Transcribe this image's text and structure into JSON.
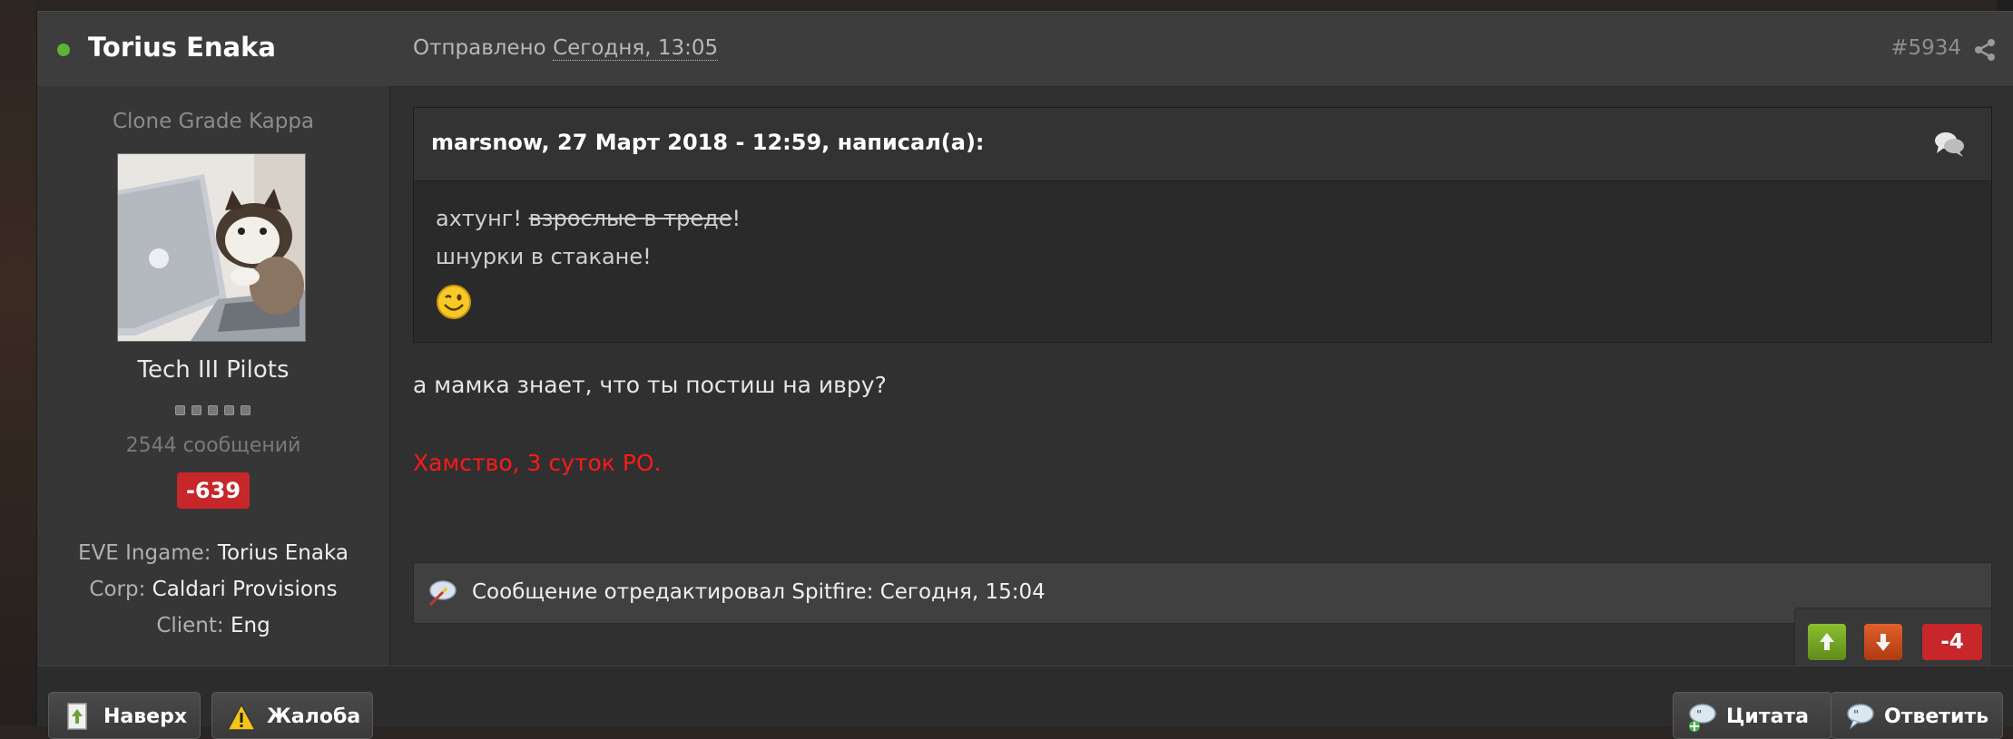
{
  "post": {
    "author": "Torius Enaka",
    "sent_label": "Отправлено",
    "sent_date": "Сегодня, 13:05",
    "post_number": "#5934"
  },
  "sidebar": {
    "user_title": "Clone Grade Kappa",
    "group": "Tech III Pilots",
    "post_count": "2544 сообщений",
    "reputation": "-639",
    "fields": [
      {
        "label": "EVE Ingame:",
        "value": "Torius Enaka"
      },
      {
        "label": "Corp:",
        "value": "Caldari Provisions"
      },
      {
        "label": "Client:",
        "value": "Eng"
      }
    ]
  },
  "quote": {
    "citation": "marsnow, 27 Март 2018 - 12:59, написал(а):",
    "line1_start": "ахтунг! ",
    "line1_strike": "взрослые в треде",
    "line1_end": "!",
    "line2": "шнурки в стакане!"
  },
  "body": {
    "text": "а мамка знает, что ты постиш на ивру?",
    "mod_note": "Хамство, 3 суток РО."
  },
  "edit_note": "Сообщение отредактировал Spitfire: Сегодня, 15:04",
  "votes": {
    "score": "-4"
  },
  "footer": {
    "top_label": "Наверх",
    "report_label": "Жалоба",
    "quote_label": "Цитата",
    "reply_label": "Ответить"
  },
  "icons": {
    "online": "online-status-icon",
    "share": "share-icon",
    "quote": "speech-bubbles-icon",
    "edit": "edit-note-icon",
    "smiley": "wink-smiley-icon",
    "up": "arrow-up-icon",
    "down": "arrow-down-icon",
    "top": "page-up-icon",
    "report": "warning-icon",
    "quote_btn": "quote-icon",
    "reply": "reply-icon"
  },
  "colors": {
    "online": "#5fb336",
    "negative_badge": "#c7262b",
    "mod_note": "#ff1a1a",
    "vote_up": "#6e9f22",
    "vote_down": "#c9491c"
  }
}
